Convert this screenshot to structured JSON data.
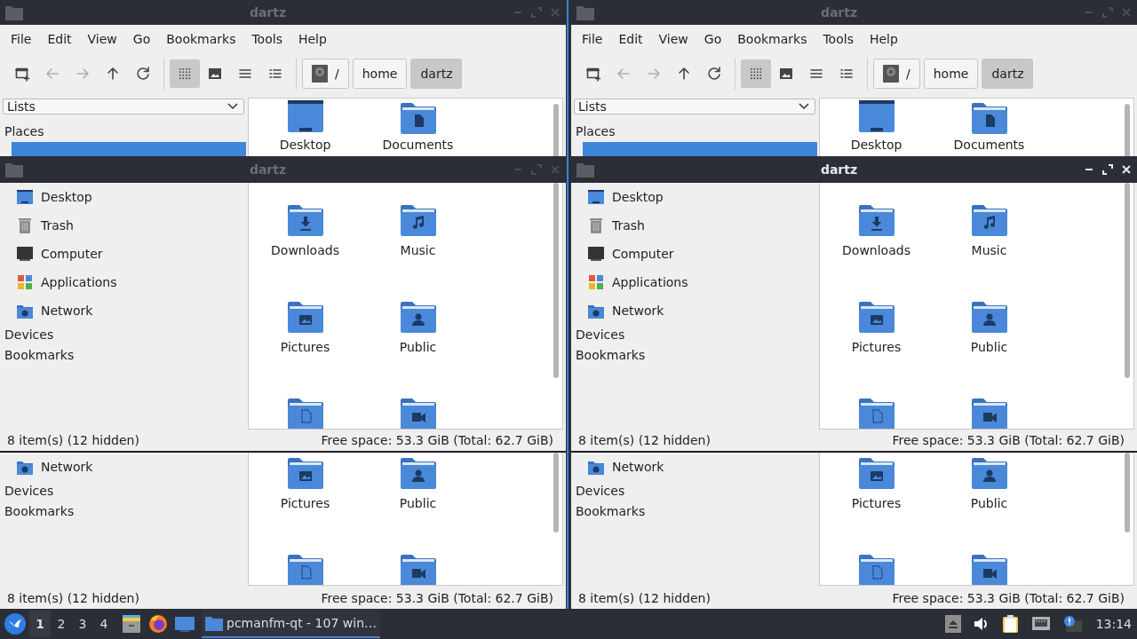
{
  "back_windows": [
    {
      "title": "dartz",
      "active": false,
      "menu": [
        "File",
        "Edit",
        "View",
        "Go",
        "Bookmarks",
        "Tools",
        "Help"
      ],
      "toolbar": [
        {
          "kind": "new-window",
          "disabled": false
        },
        {
          "kind": "back",
          "disabled": true
        },
        {
          "kind": "forward",
          "disabled": true
        },
        {
          "kind": "up",
          "disabled": false
        },
        {
          "kind": "reload",
          "disabled": false
        }
      ],
      "view_modes": [
        {
          "kind": "icons",
          "selected": true
        },
        {
          "kind": "thumbnails",
          "selected": false
        },
        {
          "kind": "compact",
          "selected": false
        },
        {
          "kind": "details",
          "selected": false
        }
      ],
      "path": [
        {
          "kind": "root",
          "label": "/",
          "selected": false
        },
        {
          "kind": "folder",
          "label": "home",
          "selected": false
        },
        {
          "kind": "folder",
          "label": "dartz",
          "selected": true
        }
      ],
      "side_pane_mode": "Lists",
      "places_heading": "Places",
      "place_selected": true,
      "files_top": [
        {
          "kind": "desktop",
          "name": "Desktop"
        },
        {
          "kind": "documents",
          "name": "Documents"
        }
      ],
      "places_bottom": [
        {
          "kind": "network",
          "name": "Network"
        }
      ],
      "sections_bottom": [
        "Devices",
        "Bookmarks"
      ],
      "files_bottom": [
        {
          "kind": "pictures",
          "name": "Pictures"
        },
        {
          "kind": "public",
          "name": "Public"
        },
        {
          "kind": "templates"
        },
        {
          "kind": "videos"
        }
      ],
      "status": {
        "items": "8 item(s) (12 hidden)",
        "free": "Free space: 53.3 GiB (Total: 62.7 GiB)"
      }
    },
    {
      "title": "dartz",
      "active": false,
      "menu": [
        "File",
        "Edit",
        "View",
        "Go",
        "Bookmarks",
        "Tools",
        "Help"
      ],
      "toolbar": [
        {
          "kind": "new-window",
          "disabled": false
        },
        {
          "kind": "back",
          "disabled": true
        },
        {
          "kind": "forward",
          "disabled": true
        },
        {
          "kind": "up",
          "disabled": false
        },
        {
          "kind": "reload",
          "disabled": false
        }
      ],
      "view_modes": [
        {
          "kind": "icons",
          "selected": true
        },
        {
          "kind": "thumbnails",
          "selected": false
        },
        {
          "kind": "compact",
          "selected": false
        },
        {
          "kind": "details",
          "selected": false
        }
      ],
      "path": [
        {
          "kind": "root",
          "label": "/",
          "selected": false
        },
        {
          "kind": "folder",
          "label": "home",
          "selected": false
        },
        {
          "kind": "folder",
          "label": "dartz",
          "selected": true
        }
      ],
      "side_pane_mode": "Lists",
      "places_heading": "Places",
      "place_selected": true,
      "files_top": [
        {
          "kind": "desktop",
          "name": "Desktop"
        },
        {
          "kind": "documents",
          "name": "Documents"
        }
      ],
      "places_bottom": [
        {
          "kind": "network",
          "name": "Network"
        }
      ],
      "sections_bottom": [
        "Devices",
        "Bookmarks"
      ],
      "files_bottom": [
        {
          "kind": "pictures",
          "name": "Pictures"
        },
        {
          "kind": "public",
          "name": "Public"
        },
        {
          "kind": "templates"
        },
        {
          "kind": "videos"
        }
      ],
      "status": {
        "items": "8 item(s) (12 hidden)",
        "free": "Free space: 53.3 GiB (Total: 62.7 GiB)"
      }
    }
  ],
  "front_windows": [
    {
      "title": "dartz",
      "active": false,
      "places": [
        {
          "kind": "desktop",
          "name": "Desktop"
        },
        {
          "kind": "trash",
          "name": "Trash"
        },
        {
          "kind": "computer",
          "name": "Computer"
        },
        {
          "kind": "applications",
          "name": "Applications"
        },
        {
          "kind": "network",
          "name": "Network"
        }
      ],
      "sections": [
        "Devices",
        "Bookmarks"
      ],
      "files": [
        {
          "kind": "downloads",
          "name": "Downloads"
        },
        {
          "kind": "music",
          "name": "Music"
        },
        {
          "kind": "pictures",
          "name": "Pictures"
        },
        {
          "kind": "public",
          "name": "Public"
        },
        {
          "kind": "templates"
        },
        {
          "kind": "videos"
        }
      ],
      "status": {
        "items": "8 item(s) (12 hidden)",
        "free": "Free space: 53.3 GiB (Total: 62.7 GiB)"
      }
    },
    {
      "title": "dartz",
      "active": true,
      "places": [
        {
          "kind": "desktop",
          "name": "Desktop"
        },
        {
          "kind": "trash",
          "name": "Trash"
        },
        {
          "kind": "computer",
          "name": "Computer"
        },
        {
          "kind": "applications",
          "name": "Applications"
        },
        {
          "kind": "network",
          "name": "Network"
        }
      ],
      "sections": [
        "Devices",
        "Bookmarks"
      ],
      "files": [
        {
          "kind": "downloads",
          "name": "Downloads"
        },
        {
          "kind": "music",
          "name": "Music"
        },
        {
          "kind": "pictures",
          "name": "Pictures"
        },
        {
          "kind": "public",
          "name": "Public"
        },
        {
          "kind": "templates"
        },
        {
          "kind": "videos"
        }
      ],
      "status": {
        "items": "8 item(s) (12 hidden)",
        "free": "Free space: 53.3 GiB (Total: 62.7 GiB)"
      }
    }
  ],
  "taskbar": {
    "launchers": [
      {
        "kind": "file-manager"
      },
      {
        "kind": "browser"
      },
      {
        "kind": "desktop"
      }
    ],
    "workspaces": [
      {
        "label": "1",
        "selected": true
      },
      {
        "label": "2",
        "selected": false
      },
      {
        "label": "3",
        "selected": false
      },
      {
        "label": "4",
        "selected": false
      }
    ],
    "tasks": [
      {
        "label": "pcmanfm-qt - 107 win…",
        "selected": true
      }
    ],
    "tray": [
      {
        "kind": "eject"
      },
      {
        "kind": "volume"
      },
      {
        "kind": "clipboard"
      },
      {
        "kind": "network"
      },
      {
        "kind": "notification"
      }
    ],
    "clock": "13:14"
  }
}
